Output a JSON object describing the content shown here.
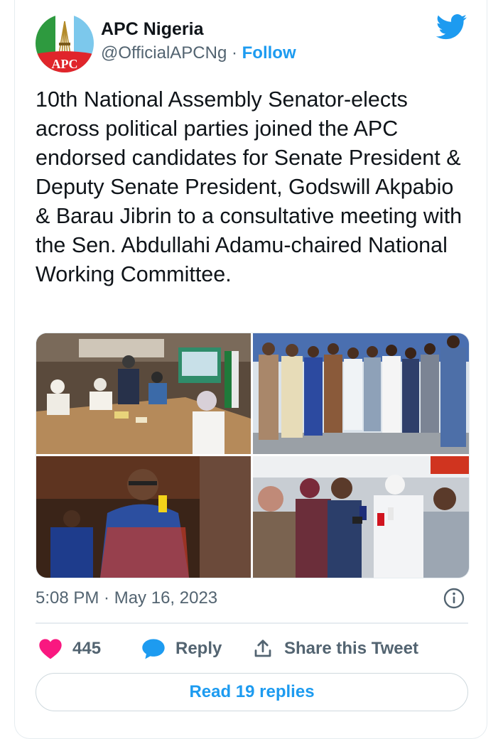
{
  "author": {
    "name": "APC Nigeria",
    "handle": "@OfficialAPCNg",
    "separator": " · ",
    "follow_label": "Follow",
    "avatar_text": "APC"
  },
  "tweet": {
    "text": "10th National Assembly Senator-elects across political parties joined the APC endorsed candidates for Senate President & Deputy Senate President, Godswill Akpabio & Barau Jibrin to a consultative meeting with the Sen. Abdullahi Adamu-chaired National Working Committee.",
    "timestamp": "5:08 PM · May 16, 2023"
  },
  "media": {
    "photo_count": 4
  },
  "actions": {
    "like_count": "445",
    "reply_label": "Reply",
    "share_label": "Share this Tweet"
  },
  "footer": {
    "read_replies_label": "Read 19 replies"
  },
  "colors": {
    "accent": "#1d9bf0",
    "like": "#f91880",
    "text_primary": "#0f1419",
    "text_secondary": "#536471"
  },
  "icons": [
    "twitter-bird-icon",
    "info-icon",
    "heart-icon",
    "reply-bubble-icon",
    "share-icon"
  ]
}
